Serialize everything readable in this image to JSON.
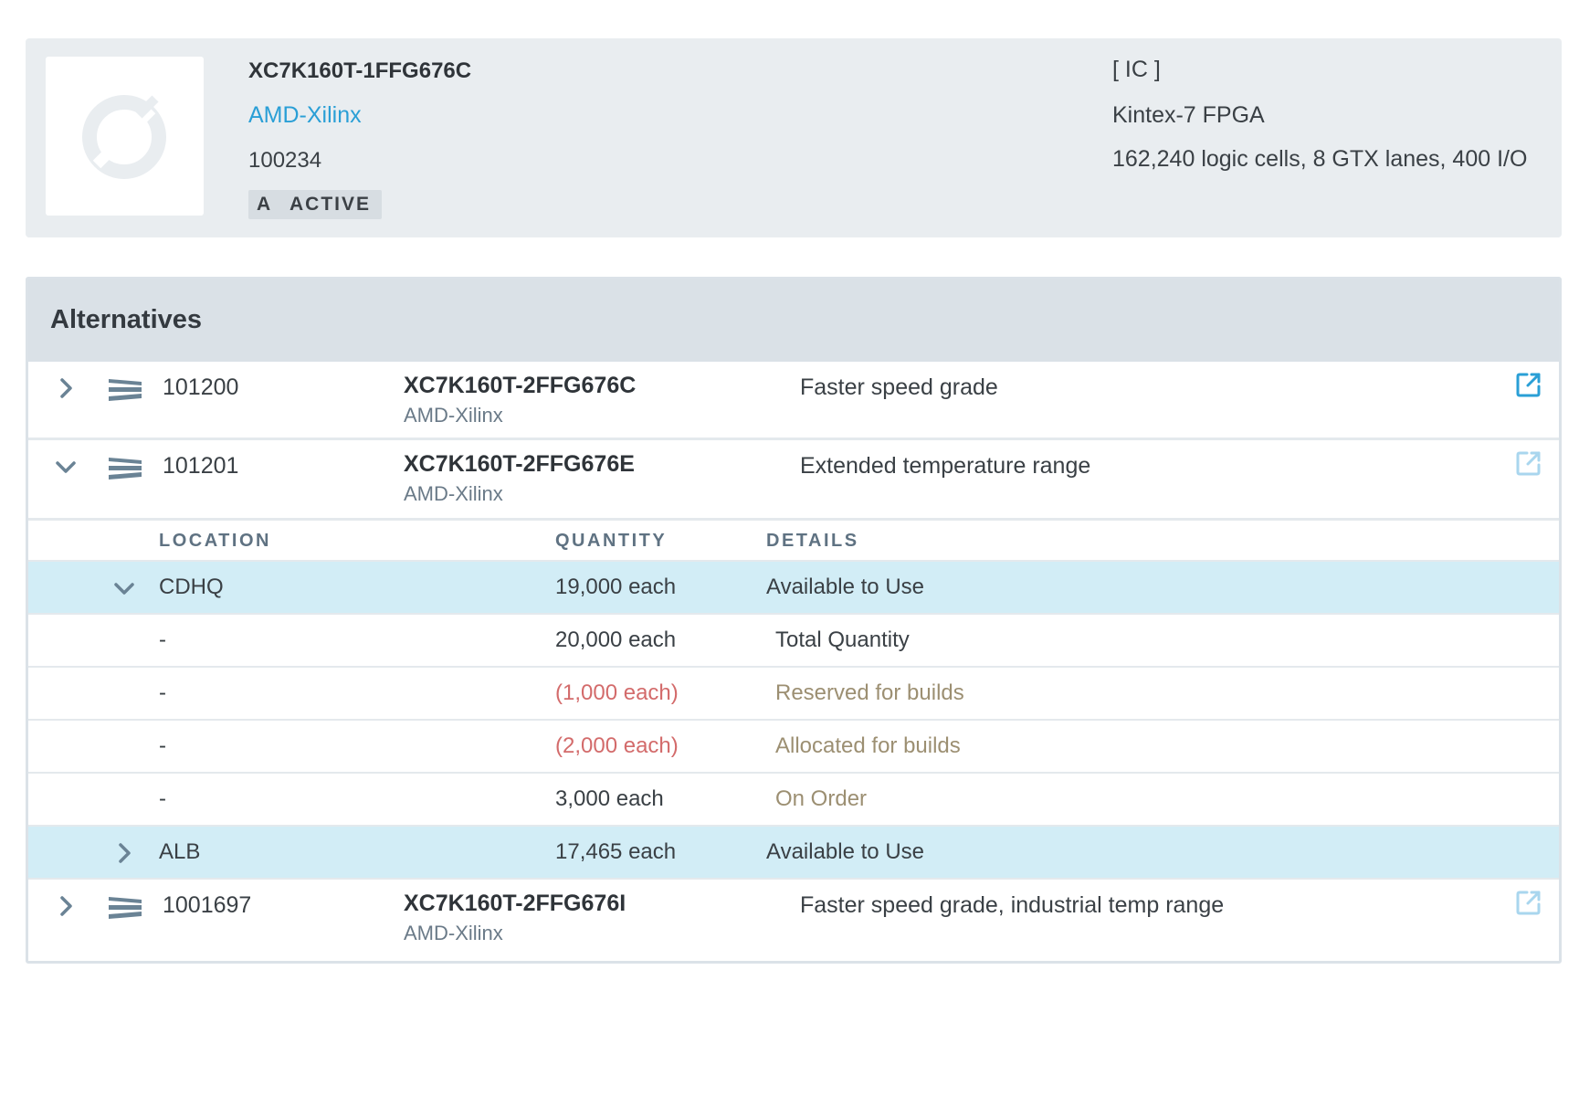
{
  "part": {
    "number": "XC7K160T-1FFG676C",
    "manufacturer": "AMD-Xilinx",
    "id": "100234",
    "revision": "A",
    "status": "ACTIVE",
    "type": "[ IC ]",
    "family": "Kintex-7 FPGA",
    "specs": "162,240 logic cells, 8 GTX lanes, 400 I/O",
    "thumbnail_icon": "broken-image-icon"
  },
  "alternatives": {
    "title": "Alternatives",
    "rows": [
      {
        "id": "101200",
        "part_number": "XC7K160T-2FFG676C",
        "manufacturer": "AMD-Xilinx",
        "note": "Faster speed grade",
        "expanded": false,
        "link_color": "#2a9fd6"
      },
      {
        "id": "101201",
        "part_number": "XC7K160T-2FFG676E",
        "manufacturer": "AMD-Xilinx",
        "note": "Extended temperature range",
        "expanded": true,
        "link_color": "#a9d6ee"
      },
      {
        "id": "1001697",
        "part_number": "XC7K160T-2FFG676I",
        "manufacturer": "AMD-Xilinx",
        "note": "Faster speed grade, industrial temp range",
        "expanded": false,
        "link_color": "#a9d6ee"
      }
    ]
  },
  "inventory": {
    "headers": {
      "location": "LOCATION",
      "quantity": "QUANTITY",
      "details": "DETAILS"
    },
    "locations": [
      {
        "name": "CDHQ",
        "quantity": "19,000 each",
        "details": "Available to Use",
        "expanded": true,
        "breakdown": [
          {
            "location": "-",
            "quantity": "20,000 each",
            "details": "Total Quantity"
          },
          {
            "location": "-",
            "quantity": "(1,000 each)",
            "details": "Reserved for builds"
          },
          {
            "location": "-",
            "quantity": "(2,000 each)",
            "details": "Allocated for builds"
          },
          {
            "location": "-",
            "quantity": "3,000 each",
            "details": "On Order"
          }
        ]
      },
      {
        "name": "ALB",
        "quantity": "17,465 each",
        "details": "Available to Use",
        "expanded": false
      }
    ]
  },
  "colors": {
    "accent": "#2a9fd6",
    "negative": "#d36b6b",
    "muted_detail": "#9c8f72",
    "location_highlight": "#d2edf6"
  }
}
